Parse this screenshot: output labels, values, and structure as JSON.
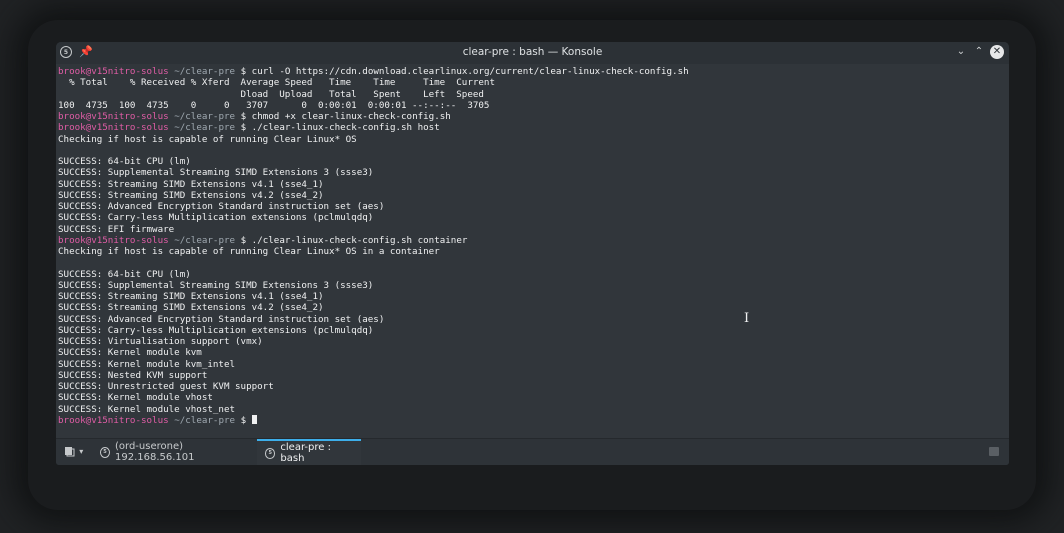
{
  "window": {
    "title": "clear-pre : bash — Konsole",
    "app_icon_text": "5",
    "pin_symbol": "📌",
    "minimize_symbol": "⌄",
    "maximize_symbol": "⌃",
    "close_symbol": "✕"
  },
  "prompt": {
    "user": "brook",
    "host": "@v15nitro-solus",
    "path": " ~/clear-pre",
    "dollar": " $ "
  },
  "terminal_lines": [
    {
      "type": "prompt",
      "cmd": "curl -O https://cdn.download.clearlinux.org/current/clear-linux-check-config.sh"
    },
    {
      "type": "out",
      "text": "  % Total    % Received % Xferd  Average Speed   Time    Time     Time  Current"
    },
    {
      "type": "out",
      "text": "                                 Dload  Upload   Total   Spent    Left  Speed"
    },
    {
      "type": "out",
      "text": "100  4735  100  4735    0     0   3707      0  0:00:01  0:00:01 --:--:--  3705"
    },
    {
      "type": "prompt",
      "cmd": "chmod +x clear-linux-check-config.sh"
    },
    {
      "type": "prompt",
      "cmd": "./clear-linux-check-config.sh host"
    },
    {
      "type": "out",
      "text": "Checking if host is capable of running Clear Linux* OS"
    },
    {
      "type": "out",
      "text": ""
    },
    {
      "type": "out",
      "text": "SUCCESS: 64-bit CPU (lm)"
    },
    {
      "type": "out",
      "text": "SUCCESS: Supplemental Streaming SIMD Extensions 3 (ssse3)"
    },
    {
      "type": "out",
      "text": "SUCCESS: Streaming SIMD Extensions v4.1 (sse4_1)"
    },
    {
      "type": "out",
      "text": "SUCCESS: Streaming SIMD Extensions v4.2 (sse4_2)"
    },
    {
      "type": "out",
      "text": "SUCCESS: Advanced Encryption Standard instruction set (aes)"
    },
    {
      "type": "out",
      "text": "SUCCESS: Carry-less Multiplication extensions (pclmulqdq)"
    },
    {
      "type": "out",
      "text": "SUCCESS: EFI firmware"
    },
    {
      "type": "prompt",
      "cmd": "./clear-linux-check-config.sh container"
    },
    {
      "type": "out",
      "text": "Checking if host is capable of running Clear Linux* OS in a container"
    },
    {
      "type": "out",
      "text": ""
    },
    {
      "type": "out",
      "text": "SUCCESS: 64-bit CPU (lm)"
    },
    {
      "type": "out",
      "text": "SUCCESS: Supplemental Streaming SIMD Extensions 3 (ssse3)"
    },
    {
      "type": "out",
      "text": "SUCCESS: Streaming SIMD Extensions v4.1 (sse4_1)"
    },
    {
      "type": "out",
      "text": "SUCCESS: Streaming SIMD Extensions v4.2 (sse4_2)"
    },
    {
      "type": "out",
      "text": "SUCCESS: Advanced Encryption Standard instruction set (aes)"
    },
    {
      "type": "out",
      "text": "SUCCESS: Carry-less Multiplication extensions (pclmulqdq)"
    },
    {
      "type": "out",
      "text": "SUCCESS: Virtualisation support (vmx)"
    },
    {
      "type": "out",
      "text": "SUCCESS: Kernel module kvm"
    },
    {
      "type": "out",
      "text": "SUCCESS: Kernel module kvm_intel"
    },
    {
      "type": "out",
      "text": "SUCCESS: Nested KVM support"
    },
    {
      "type": "out",
      "text": "SUCCESS: Unrestricted guest KVM support"
    },
    {
      "type": "out",
      "text": "SUCCESS: Kernel module vhost"
    },
    {
      "type": "out",
      "text": "SUCCESS: Kernel module vhost_net"
    },
    {
      "type": "prompt",
      "cmd": "",
      "cursor": true
    }
  ],
  "tabs": [
    {
      "label": "(ord-userone) 192.168.56.101",
      "active": false
    },
    {
      "label": "clear-pre : bash",
      "active": true
    }
  ],
  "tab_icon_text": "5",
  "new_tab_symbol": "▾",
  "ibeam_symbol": "I",
  "colors": {
    "prompt_user": "#e05da6",
    "prompt_path": "#9fa8b0",
    "active_tab_accent": "#3daee9",
    "terminal_bg": "#31363b"
  }
}
